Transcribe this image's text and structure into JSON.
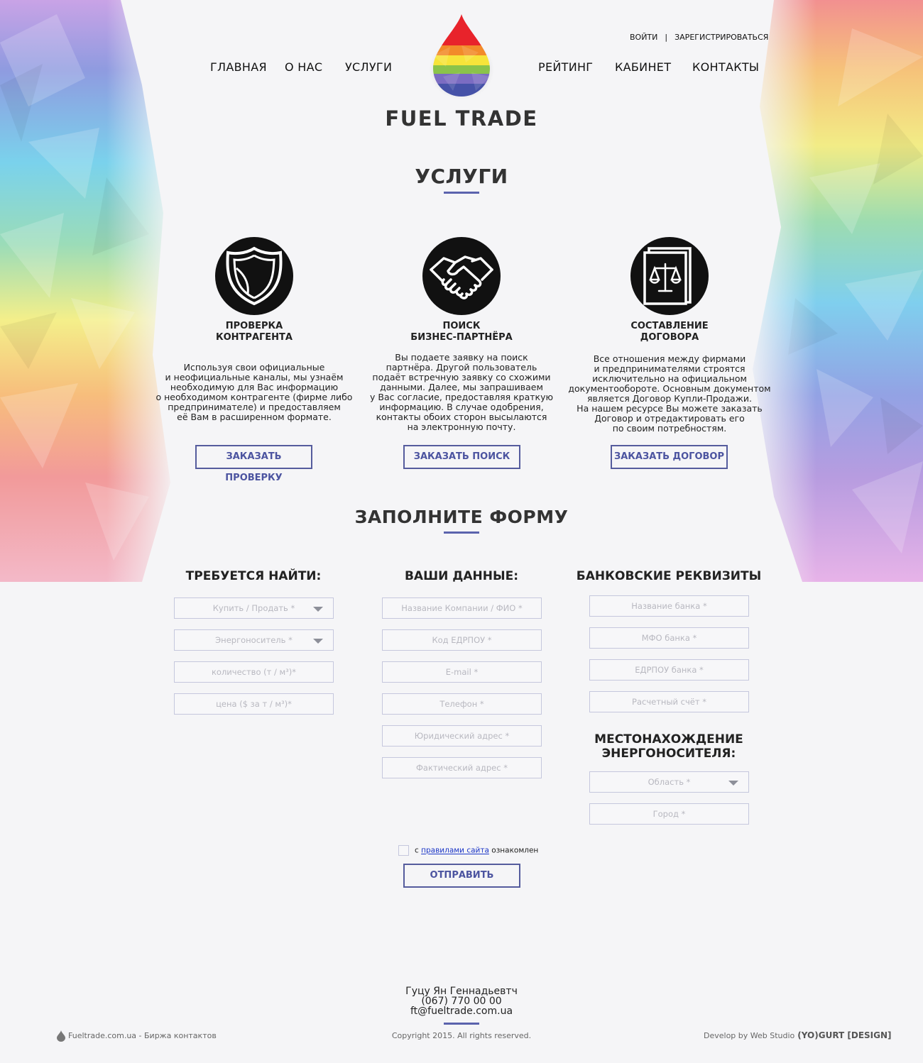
{
  "header": {
    "auth": {
      "login": "ВОЙТИ",
      "separator": "|",
      "register": "ЗАРЕГИСТРИРОВАТЬСЯ"
    },
    "nav_left": [
      "ГЛАВНАЯ",
      "О НАС",
      "УСЛУГИ"
    ],
    "nav_right": [
      "РЕЙТИНГ",
      "КАБИНЕТ",
      "КОНТАКТЫ"
    ],
    "logo_text": "FUEL TRADE"
  },
  "services": {
    "title": "УСЛУГИ",
    "items": [
      {
        "icon": "shield-icon",
        "title_line1": "ПРОВЕРКА",
        "title_line2": "КОНТРАГЕНТА",
        "description": "Используя свои официальные\nи неофициальные каналы, мы узнаём\nнеобходимую для Вас информацию\nо необходимом контрагенте (фирме либо\nпредпринимателе) и предоставляем\nеё Вам в расширенном формате.",
        "button": "ЗАКАЗАТЬ ПРОВЕРКУ"
      },
      {
        "icon": "handshake-icon",
        "title_line1": "ПОИСК",
        "title_line2": "БИЗНЕС-ПАРТНЁРА",
        "description": "Вы подаете заявку на поиск\nпартнёра. Другой пользователь\nподаёт встречную заявку со схожими\nданными. Далее, мы запрашиваем\nу Вас согласие, предоставляя краткую\nинформацию. В случае одобрения,\nконтакты обоих сторон высылаются\nна электронную почту.",
        "button": "ЗАКАЗАТЬ ПОИСК"
      },
      {
        "icon": "scales-document-icon",
        "title_line1": "СОСТАВЛЕНИЕ",
        "title_line2": "ДОГОВОРА",
        "description": "Все отношения между фирмами\nи предпринимателями строятся\nисключительно на официальном\nдокументообороте. Основным документом\nявляется Договор Купли-Продажи.\nНа нашем ресурсе Вы можете заказать\nДоговор и отредактировать его\nпо своим потребностям.",
        "button": "ЗАКАЗАТЬ ДОГОВОР"
      }
    ]
  },
  "form": {
    "title": "ЗАПОЛНИТЕ ФОРМУ",
    "col1": {
      "title": "ТРЕБУЕТСЯ НАЙТИ:",
      "fields": [
        "Купить / Продать *",
        "Энергоноситель *",
        "количество (т / м³)*",
        "цена ($ за т / м³)*"
      ]
    },
    "col2": {
      "title": "ВАШИ ДАННЫЕ:",
      "fields": [
        "Название Компании / ФИО *",
        "Код ЕДРПОУ *",
        "E-mail *",
        "Телефон *",
        "Юридический адрес *",
        "Фактический адрес *"
      ]
    },
    "col3": {
      "title": "БАНКОВСКИЕ РЕКВИЗИТЫ",
      "fields": [
        "Название банка *",
        "МФО банка *",
        "ЕДРПОУ банка *",
        "Расчетный счёт *"
      ],
      "location_title_line1": "МЕСТОНАХОЖДЕНИЕ",
      "location_title_line2": "ЭНЕРГОНОСИТЕЛЯ:",
      "location_fields": [
        "Область *",
        "Город *"
      ]
    },
    "agree_prefix": "с",
    "agree_link": "правилами сайта",
    "agree_suffix": "ознакомлен",
    "submit": "ОТПРАВИТЬ"
  },
  "contacts": {
    "name": "Гуцу Ян Геннадьевтч",
    "phone": "(067) 770 00 00",
    "email": "ft@fueltrade.com.ua"
  },
  "footer": {
    "left": "Fueltrade.com.ua - Биржа контактов",
    "copyright": "Copyright 2015. All rights reserved.",
    "develop": "Develop by Web Studio",
    "studio": "(YO)GURT [DESIGN]"
  },
  "colors": {
    "accent": "#5b63ad",
    "button_text": "#4c54a0",
    "text": "#222222",
    "background": "#f5f5f7"
  }
}
